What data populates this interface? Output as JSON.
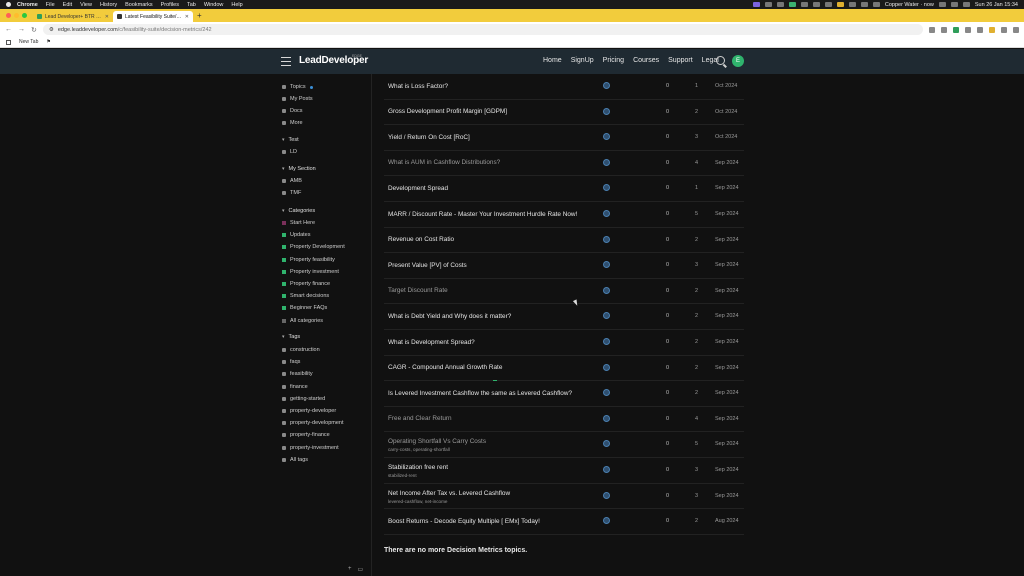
{
  "menubar": {
    "app": "Chrome",
    "items": [
      "File",
      "Edit",
      "View",
      "History",
      "Bookmarks",
      "Profiles",
      "Tab",
      "Window",
      "Help"
    ],
    "status_text": "Copper Water · now",
    "datetime": "Sun 26 Jan  15:34"
  },
  "tabs": [
    {
      "label": "Lead Developer+ BTR _ Su...",
      "active": false
    },
    {
      "label": "Latest Feasibility Suite/Decis...",
      "active": true
    }
  ],
  "address": {
    "domain": "edge.leaddeveloper.com",
    "path": "/c/feasibility-suite/decision-metrics/242"
  },
  "bookmarks": {
    "new_tab": "New Tab"
  },
  "site": {
    "logo": "LeadDeveloper",
    "logo_badge": "EDGE",
    "nav": [
      "Home",
      "SignUp",
      "Pricing",
      "Courses",
      "Support",
      "Legal"
    ],
    "avatar_letter": "E"
  },
  "sidebar": {
    "top": [
      "Topics",
      "My Posts",
      "Docs",
      "More"
    ],
    "test_section": {
      "title": "Test",
      "items": [
        "LD"
      ]
    },
    "my_section": {
      "title": "My Section",
      "items": [
        "AMB",
        "TMF"
      ]
    },
    "categories": {
      "title": "Categories",
      "items": [
        "Start Here",
        "Updates",
        "Property Development",
        "Property feasibility",
        "Property investment",
        "Property finance",
        "Smart decisions",
        "Beginner FAQs",
        "All categories"
      ],
      "colors": [
        "#7a2f5a",
        "#2fb36d",
        "#2fb36d",
        "#2fb36d",
        "#2fb36d",
        "#2fb36d",
        "#2fb36d",
        "#2fb36d",
        "#666666"
      ]
    },
    "tags": {
      "title": "Tags",
      "items": [
        "construction",
        "faqs",
        "feasibility",
        "finance",
        "getting-started",
        "property-developer",
        "property-development",
        "property-finance",
        "property-investment",
        "All tags"
      ]
    }
  },
  "topics": [
    {
      "title": "What is Loss Factor?",
      "replies": "0",
      "views": "1",
      "activity": "Oct 2024"
    },
    {
      "title": "Gross Development Profit Margin [GDPM]",
      "replies": "0",
      "views": "2",
      "activity": "Oct 2024"
    },
    {
      "title": "Yield / Return On Cost [RoC]",
      "replies": "0",
      "views": "3",
      "activity": "Oct 2024"
    },
    {
      "title": "What is AUM in Cashflow Distributions?",
      "replies": "0",
      "views": "4",
      "activity": "Sep 2024",
      "visited": true
    },
    {
      "title": "Development Spread",
      "replies": "0",
      "views": "1",
      "activity": "Sep 2024"
    },
    {
      "title": "MARR / Discount Rate - Master Your Investment Hurdle Rate Now!",
      "replies": "0",
      "views": "5",
      "activity": "Sep 2024"
    },
    {
      "title": "Revenue on Cost Ratio",
      "replies": "0",
      "views": "2",
      "activity": "Sep 2024"
    },
    {
      "title": "Present Value [PV] of Costs",
      "replies": "0",
      "views": "3",
      "activity": "Sep 2024"
    },
    {
      "title": "Target Discount Rate",
      "replies": "0",
      "views": "2",
      "activity": "Sep 2024",
      "visited": true
    },
    {
      "title": "What is Debt Yield and Why does it matter?",
      "replies": "0",
      "views": "2",
      "activity": "Sep 2024"
    },
    {
      "title": "What is Development Spread?",
      "replies": "0",
      "views": "2",
      "activity": "Sep 2024"
    },
    {
      "title": "CAGR - Compound Annual Growth Rate",
      "replies": "0",
      "views": "2",
      "activity": "Sep 2024"
    },
    {
      "title": "Is Levered Investment Cashflow the same as Levered Cashflow?",
      "replies": "0",
      "views": "2",
      "activity": "Sep 2024"
    },
    {
      "title": "Free and Clear Return",
      "replies": "0",
      "views": "4",
      "activity": "Sep 2024",
      "visited": true
    },
    {
      "title": "Operating Shortfall Vs Carry Costs",
      "tags": "carry-costs, operating-shortfall",
      "replies": "0",
      "views": "5",
      "activity": "Sep 2024",
      "visited": true
    },
    {
      "title": "Stabilization free rent",
      "tags": "stabilized-rent",
      "replies": "0",
      "views": "3",
      "activity": "Sep 2024"
    },
    {
      "title": "Net Income After Tax vs. Levered Cashflow",
      "tags": "levered-cashflow, net-income",
      "replies": "0",
      "views": "3",
      "activity": "Sep 2024"
    },
    {
      "title": "Boost Returns - Decode Equity Multiple [ EMx] Today!",
      "replies": "0",
      "views": "2",
      "activity": "Aug 2024"
    }
  ],
  "footer_message": "There are no more Decision Metrics topics."
}
